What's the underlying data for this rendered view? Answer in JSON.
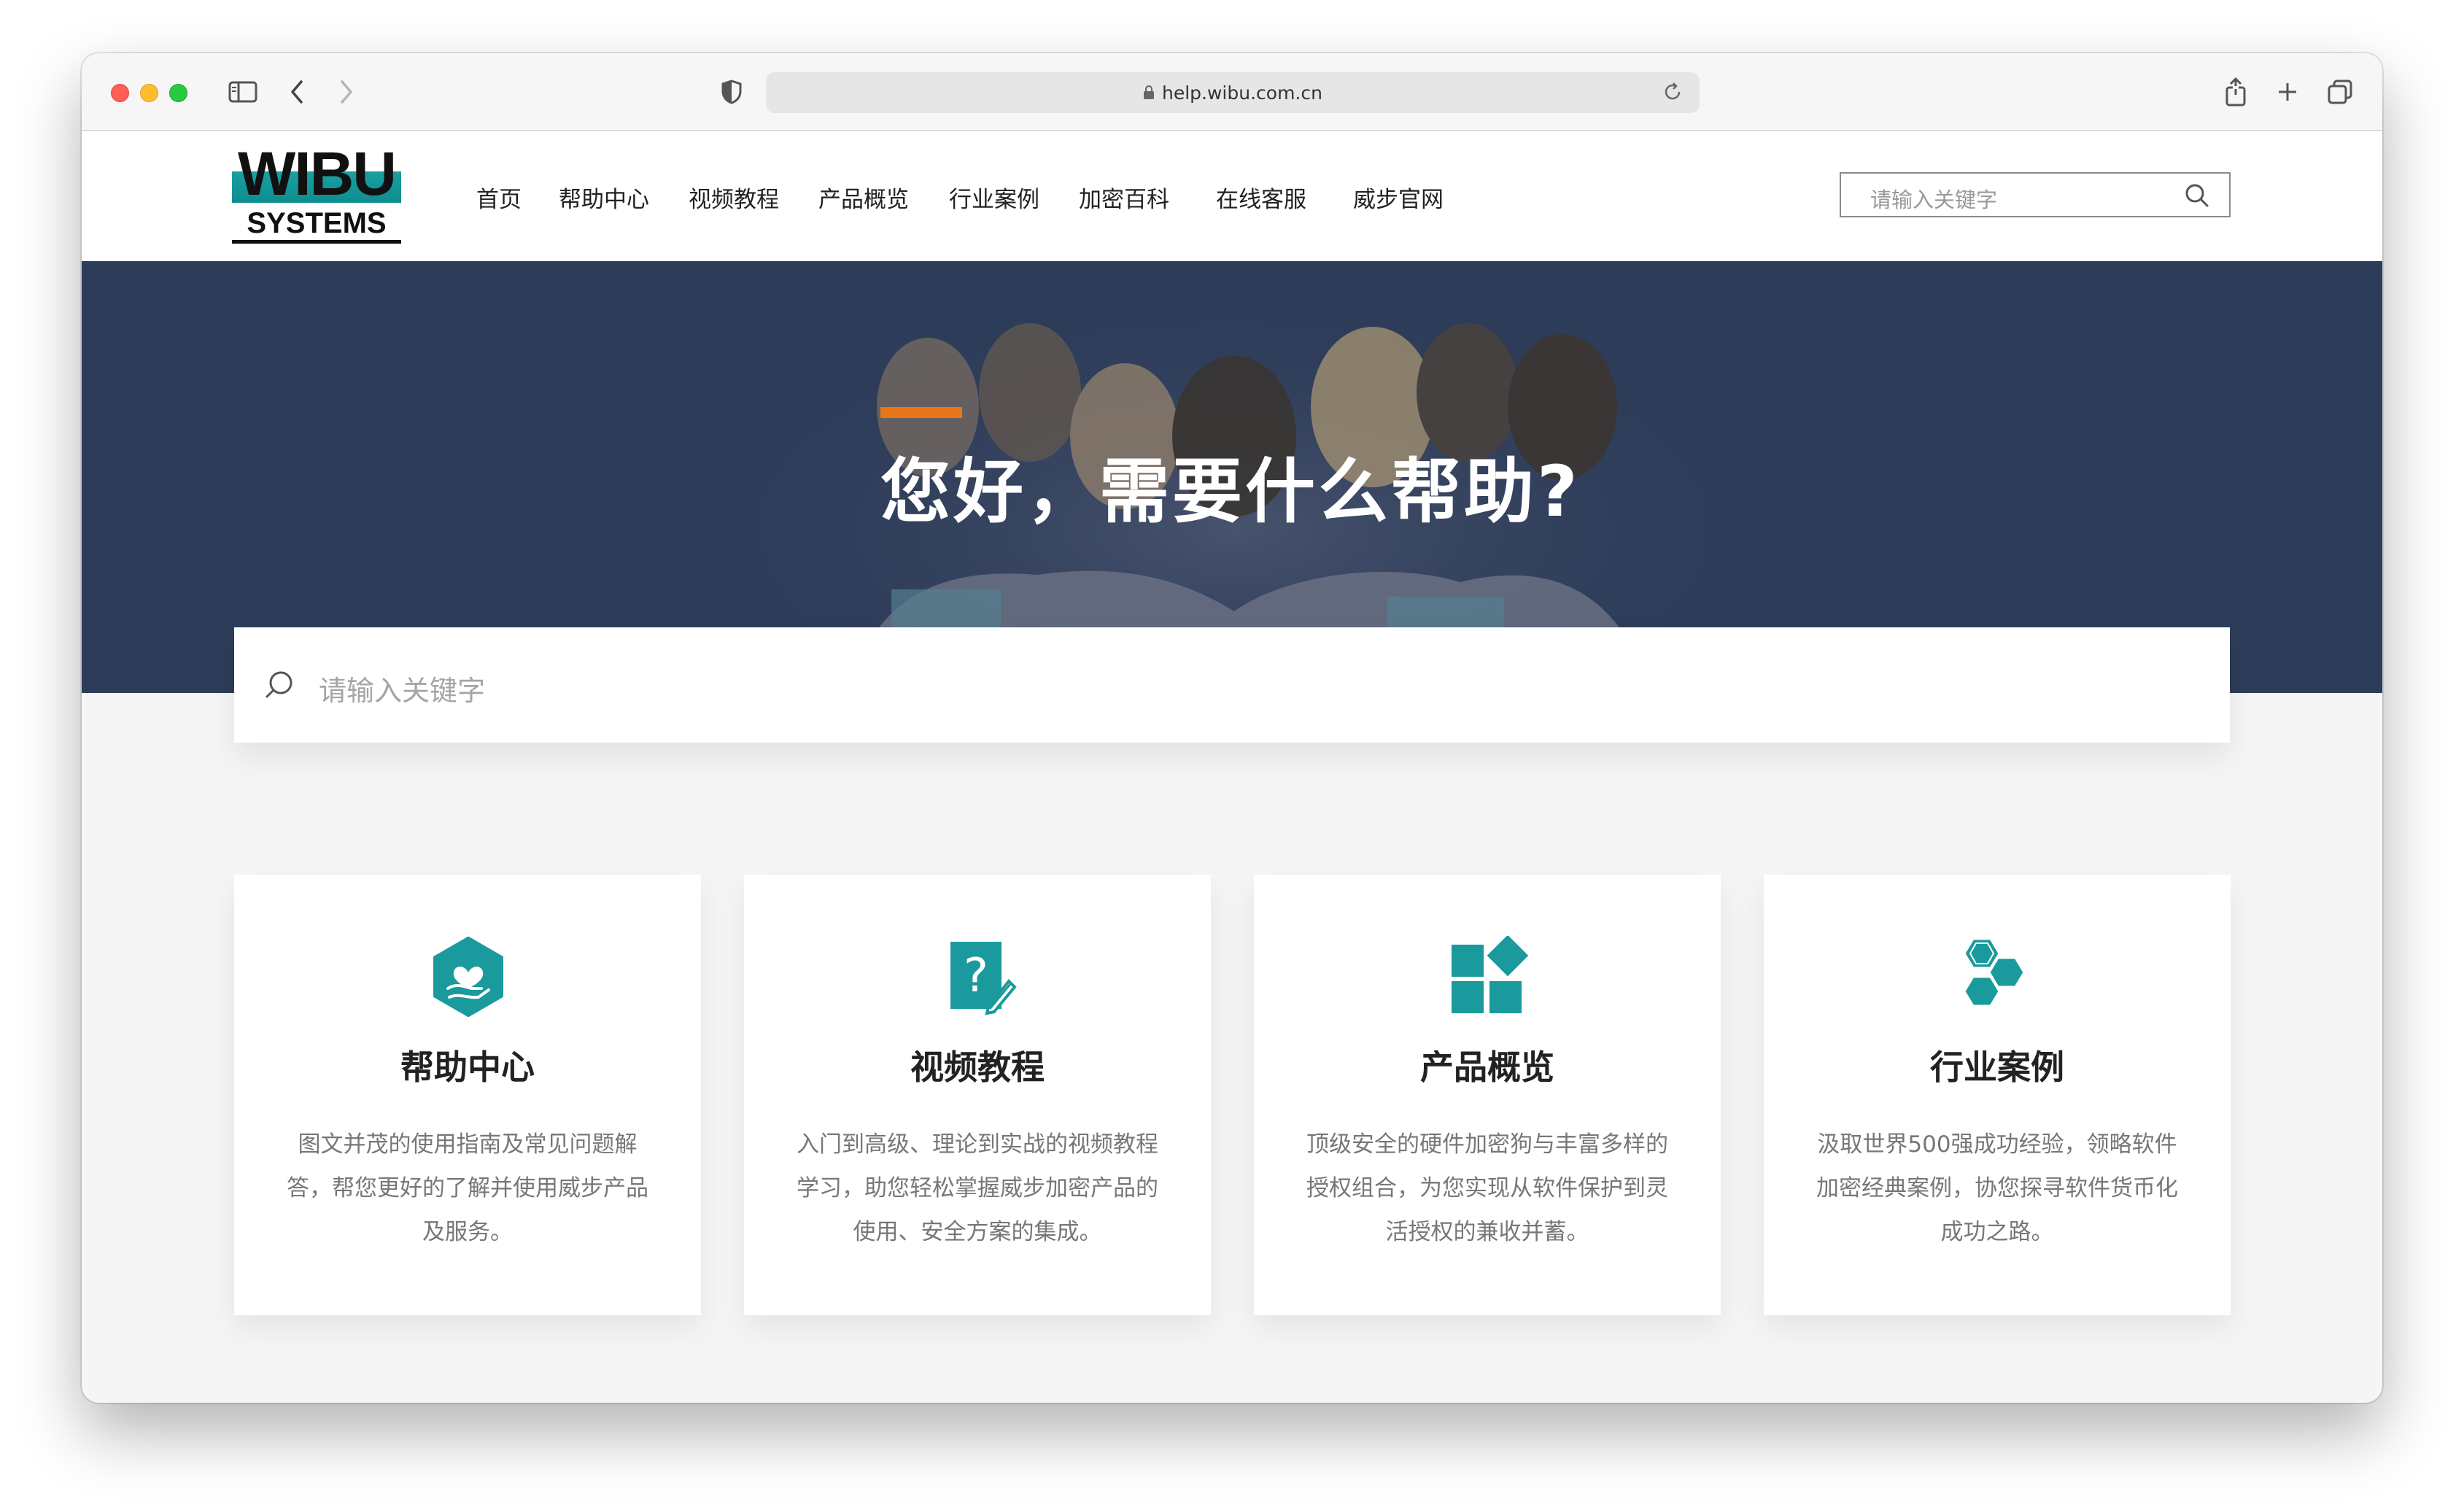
{
  "browser": {
    "url": "help.wibu.com.cn"
  },
  "site": {
    "logo": {
      "top": "WIBU",
      "bottom": "SYSTEMS"
    },
    "nav": [
      "首页",
      "帮助中心",
      "视频教程",
      "产品概览",
      "行业案例",
      "加密百科",
      "在线客服",
      "威步官网"
    ],
    "header_search_placeholder": "请输入关键字"
  },
  "hero": {
    "title": "您好，需要什么帮助?",
    "search_placeholder": "请输入关键字"
  },
  "cards": [
    {
      "icon": "heart-hand-icon",
      "title": "帮助中心",
      "desc": "图文并茂的使用指南及常见问题解答，帮您更好的了解并使用威步产品及服务。"
    },
    {
      "icon": "question-doc-icon",
      "title": "视频教程",
      "desc": "入门到高级、理论到实战的视频教程学习，助您轻松掌握威步加密产品的使用、安全方案的集成。"
    },
    {
      "icon": "blocks-icon",
      "title": "产品概览",
      "desc": "顶级安全的硬件加密狗与丰富多样的授权组合，为您实现从软件保护到灵活授权的兼收并蓄。"
    },
    {
      "icon": "hexagons-icon",
      "title": "行业案例",
      "desc": "汲取世界500强成功经验，领略软件加密经典案例，协您探寻软件货币化成功之路。"
    }
  ],
  "colors": {
    "hero_bg": "#2d3c59",
    "accent": "#e8761b",
    "teal": "#1a9a9c"
  }
}
